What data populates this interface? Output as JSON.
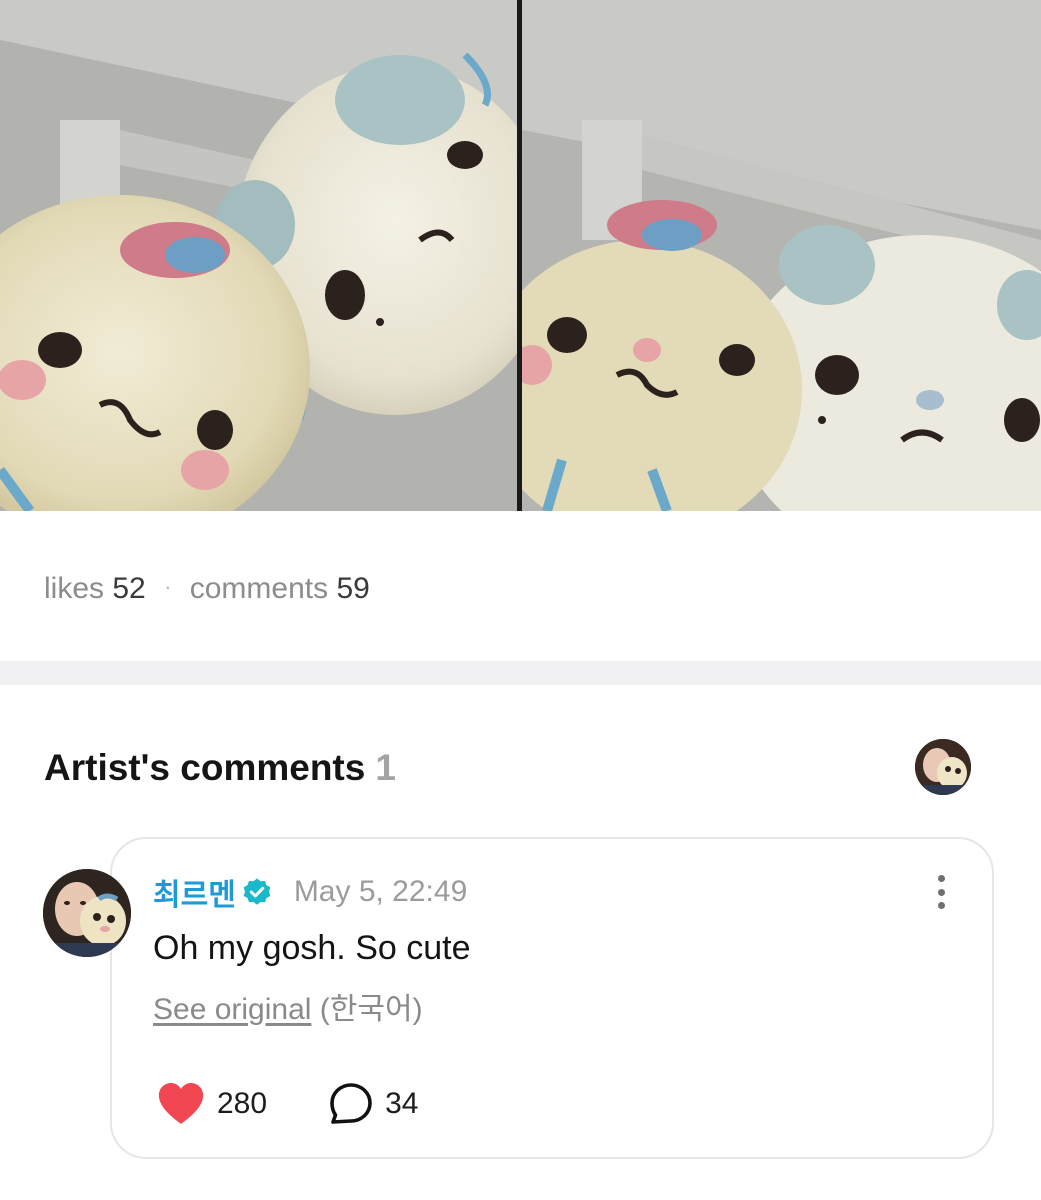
{
  "post": {
    "images": [
      {
        "alt": "photo-1"
      },
      {
        "alt": "photo-2"
      }
    ]
  },
  "stats": {
    "likes_label": "likes",
    "likes_count": "52",
    "separator": "·",
    "comments_label": "comments",
    "comments_count": "59"
  },
  "artist_comments": {
    "title": "Artist's comments",
    "count": "1",
    "comments": [
      {
        "author": "최르멘",
        "verified": true,
        "timestamp": "May 5, 22:49",
        "text": "Oh my gosh. So cute",
        "see_original_label": "See original",
        "original_language": "(한국어)",
        "like_count": "280",
        "reply_count": "34"
      }
    ]
  },
  "icons": {
    "verified": "verified-badge-icon",
    "like": "heart-icon",
    "reply": "speech-bubble-icon",
    "more": "more-vertical-icon"
  },
  "colors": {
    "author_name": "#1f9ad6",
    "verified_badge": "#19b9c9",
    "heart": "#f04752",
    "muted_text": "#8c8c8c"
  }
}
